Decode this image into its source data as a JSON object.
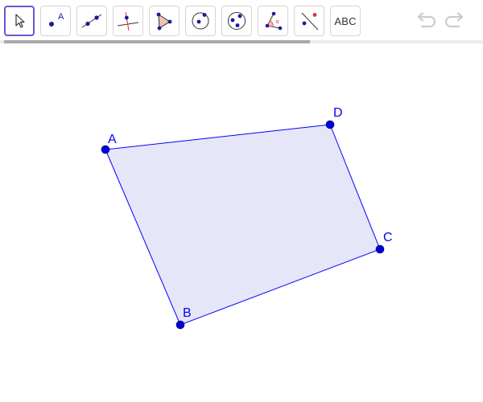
{
  "toolbar": {
    "tools": [
      {
        "name": "move-tool",
        "icon": "cursor-arrow-icon"
      },
      {
        "name": "point-tool",
        "icon": "point-icon",
        "label": "A"
      },
      {
        "name": "line-tool",
        "icon": "line-through-points-icon"
      },
      {
        "name": "perpendicular-line-tool",
        "icon": "perpendicular-line-icon"
      },
      {
        "name": "polygon-tool",
        "icon": "polygon-icon"
      },
      {
        "name": "circle-tool",
        "icon": "circle-center-point-icon"
      },
      {
        "name": "circle-three-points-tool",
        "icon": "circle-three-points-icon"
      },
      {
        "name": "angle-tool",
        "icon": "angle-icon",
        "label": "α"
      },
      {
        "name": "reflect-tool",
        "icon": "reflect-about-line-icon"
      },
      {
        "name": "text-tool",
        "label": "ABC"
      }
    ],
    "undo_icon": "undo-icon",
    "redo_icon": "redo-icon"
  },
  "geometry": {
    "polygon_fill": "#e5e6f8",
    "stroke_color": "#0000ff",
    "point_color": "#0000d8",
    "points": [
      {
        "label": "A"
      },
      {
        "label": "B"
      },
      {
        "label": "C"
      },
      {
        "label": "D"
      }
    ]
  },
  "colors": {
    "active_tool_border": "#6557d2",
    "accent_blue": "#0000ff",
    "icon_point": "#1a1a9e",
    "icon_red": "#d93636"
  }
}
